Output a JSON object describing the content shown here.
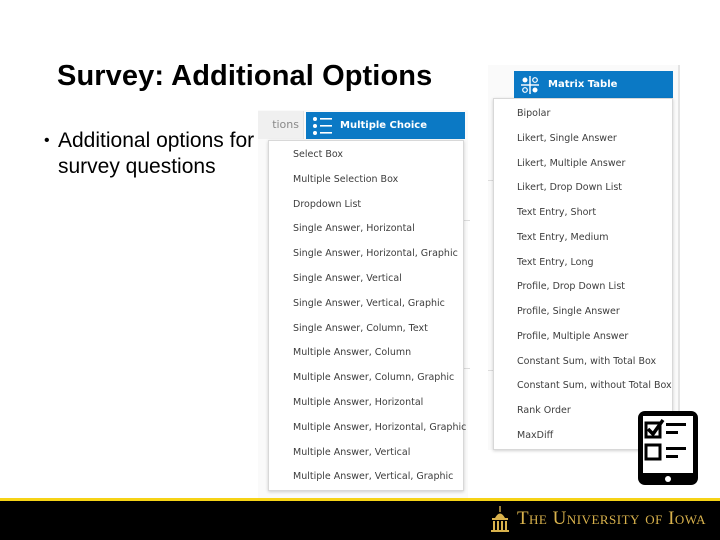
{
  "slide": {
    "title": "Survey: Additional Options",
    "bullets": [
      "Additional options for survey questions"
    ],
    "bullet_char": "•"
  },
  "left_panel": {
    "previous_tab_label": "tions",
    "header": {
      "icon": "list-icon",
      "label": "Multiple Choice"
    },
    "items": [
      "Select Box",
      "Multiple Selection Box",
      "Dropdown List",
      "Single Answer, Horizontal",
      "Single Answer, Horizontal, Graphic",
      "Single Answer, Vertical",
      "Single Answer, Vertical, Graphic",
      "Single Answer, Column, Text",
      "Multiple Answer, Column",
      "Multiple Answer, Column, Graphic",
      "Multiple Answer, Horizontal",
      "Multiple Answer, Horizontal, Graphic",
      "Multiple Answer, Vertical",
      "Multiple Answer, Vertical, Graphic"
    ]
  },
  "right_panel": {
    "header": {
      "icon": "matrix-icon",
      "label": "Matrix Table"
    },
    "items": [
      "Bipolar",
      "Likert, Single Answer",
      "Likert, Multiple Answer",
      "Likert, Drop Down List",
      "Text Entry, Short",
      "Text Entry, Medium",
      "Text Entry, Long",
      "Profile, Drop Down List",
      "Profile, Single Answer",
      "Profile, Multiple Answer",
      "Constant Sum, with Total Box",
      "Constant Sum, without Total Box",
      "Rank Order",
      "MaxDiff"
    ]
  },
  "decor": {
    "survey_icon": "survey-tablet-icon"
  },
  "footer": {
    "logo_text": "The University of Iowa",
    "logo_icon": "old-capitol-dome-icon"
  },
  "colors": {
    "accent_blue": "#0b79c5",
    "footer_black": "#000000",
    "footer_gold": "#f6d317",
    "logo_gold": "#d9b24c"
  }
}
